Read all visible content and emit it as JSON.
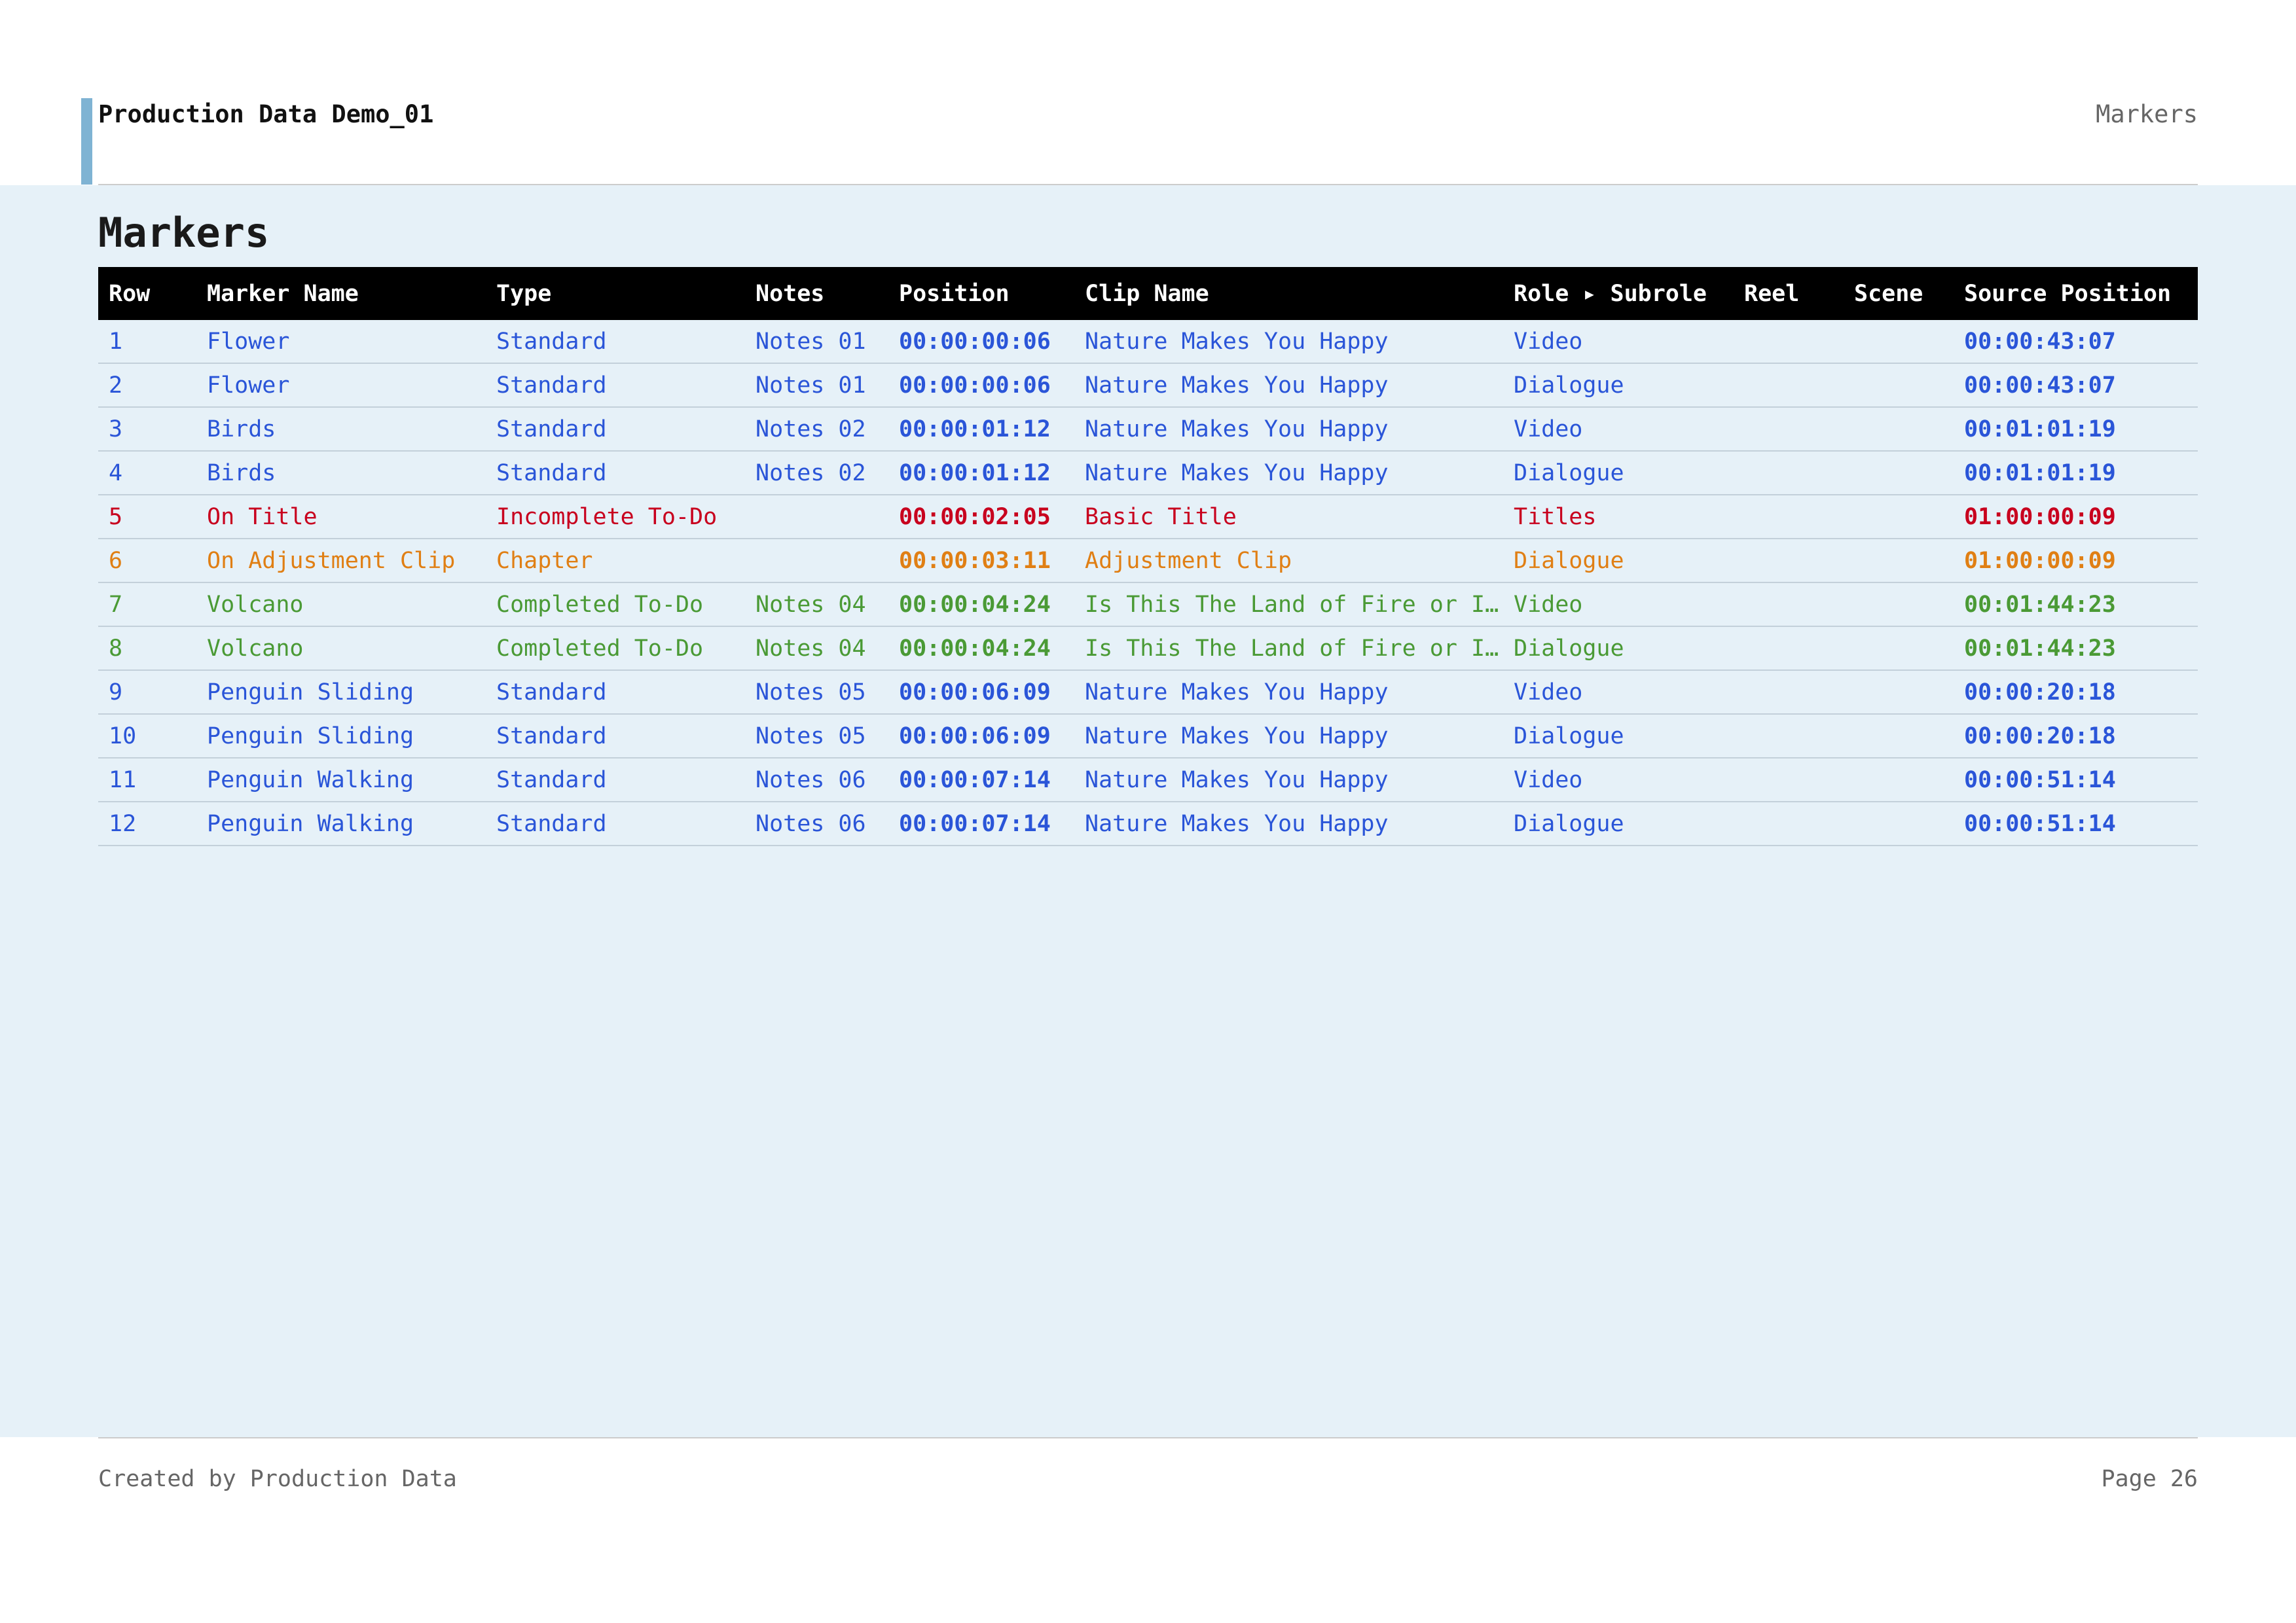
{
  "header": {
    "title": "Production Data Demo_01",
    "section": "Markers",
    "accent_color": "#7fb3d3"
  },
  "page_heading": "Markers",
  "table": {
    "columns": [
      "Row",
      "Marker Name",
      "Type",
      "Notes",
      "Position",
      "Clip Name",
      "Role ▸ Subrole",
      "Reel",
      "Scene",
      "Source Position"
    ],
    "rows": [
      {
        "row": "1",
        "marker_name": "Flower",
        "type": "Standard",
        "notes": "Notes 01",
        "position": "00:00:00:06",
        "clip_name": "Nature Makes You Happy",
        "role": "Video",
        "reel": "",
        "scene": "",
        "source_position": "00:00:43:07",
        "color": "blue"
      },
      {
        "row": "2",
        "marker_name": "Flower",
        "type": "Standard",
        "notes": "Notes 01",
        "position": "00:00:00:06",
        "clip_name": "Nature Makes You Happy",
        "role": "Dialogue",
        "reel": "",
        "scene": "",
        "source_position": "00:00:43:07",
        "color": "blue"
      },
      {
        "row": "3",
        "marker_name": "Birds",
        "type": "Standard",
        "notes": "Notes 02",
        "position": "00:00:01:12",
        "clip_name": "Nature Makes You Happy",
        "role": "Video",
        "reel": "",
        "scene": "",
        "source_position": "00:01:01:19",
        "color": "blue"
      },
      {
        "row": "4",
        "marker_name": "Birds",
        "type": "Standard",
        "notes": "Notes 02",
        "position": "00:00:01:12",
        "clip_name": "Nature Makes You Happy",
        "role": "Dialogue",
        "reel": "",
        "scene": "",
        "source_position": "00:01:01:19",
        "color": "blue"
      },
      {
        "row": "5",
        "marker_name": "On Title",
        "type": "Incomplete To-Do",
        "notes": "",
        "position": "00:00:02:05",
        "clip_name": "Basic Title",
        "role": "Titles",
        "reel": "",
        "scene": "",
        "source_position": "01:00:00:09",
        "color": "red"
      },
      {
        "row": "6",
        "marker_name": "On Adjustment Clip",
        "type": "Chapter",
        "notes": "",
        "position": "00:00:03:11",
        "clip_name": "Adjustment Clip",
        "role": "Dialogue",
        "reel": "",
        "scene": "",
        "source_position": "01:00:00:09",
        "color": "orange"
      },
      {
        "row": "7",
        "marker_name": "Volcano",
        "type": "Completed To-Do",
        "notes": "Notes 04",
        "position": "00:00:04:24",
        "clip_name": "Is This The Land of Fire or I…",
        "role": "Video",
        "reel": "",
        "scene": "",
        "source_position": "00:01:44:23",
        "color": "green"
      },
      {
        "row": "8",
        "marker_name": "Volcano",
        "type": "Completed To-Do",
        "notes": "Notes 04",
        "position": "00:00:04:24",
        "clip_name": "Is This The Land of Fire or I…",
        "role": "Dialogue",
        "reel": "",
        "scene": "",
        "source_position": "00:01:44:23",
        "color": "green"
      },
      {
        "row": "9",
        "marker_name": "Penguin Sliding",
        "type": "Standard",
        "notes": "Notes 05",
        "position": "00:00:06:09",
        "clip_name": "Nature Makes You Happy",
        "role": "Video",
        "reel": "",
        "scene": "",
        "source_position": "00:00:20:18",
        "color": "blue"
      },
      {
        "row": "10",
        "marker_name": "Penguin Sliding",
        "type": "Standard",
        "notes": "Notes 05",
        "position": "00:00:06:09",
        "clip_name": "Nature Makes You Happy",
        "role": "Dialogue",
        "reel": "",
        "scene": "",
        "source_position": "00:00:20:18",
        "color": "blue"
      },
      {
        "row": "11",
        "marker_name": "Penguin Walking",
        "type": "Standard",
        "notes": "Notes 06",
        "position": "00:00:07:14",
        "clip_name": "Nature Makes You Happy",
        "role": "Video",
        "reel": "",
        "scene": "",
        "source_position": "00:00:51:14",
        "color": "blue"
      },
      {
        "row": "12",
        "marker_name": "Penguin Walking",
        "type": "Standard",
        "notes": "Notes 06",
        "position": "00:00:07:14",
        "clip_name": "Nature Makes You Happy",
        "role": "Dialogue",
        "reel": "",
        "scene": "",
        "source_position": "00:00:51:14",
        "color": "blue"
      }
    ]
  },
  "status_colors": {
    "blue": "#2a55d8",
    "red": "#c8001e",
    "orange": "#e07f14",
    "green": "#4a9a35"
  },
  "footer": {
    "left": "Created by Production Data",
    "right": "Page 26"
  }
}
